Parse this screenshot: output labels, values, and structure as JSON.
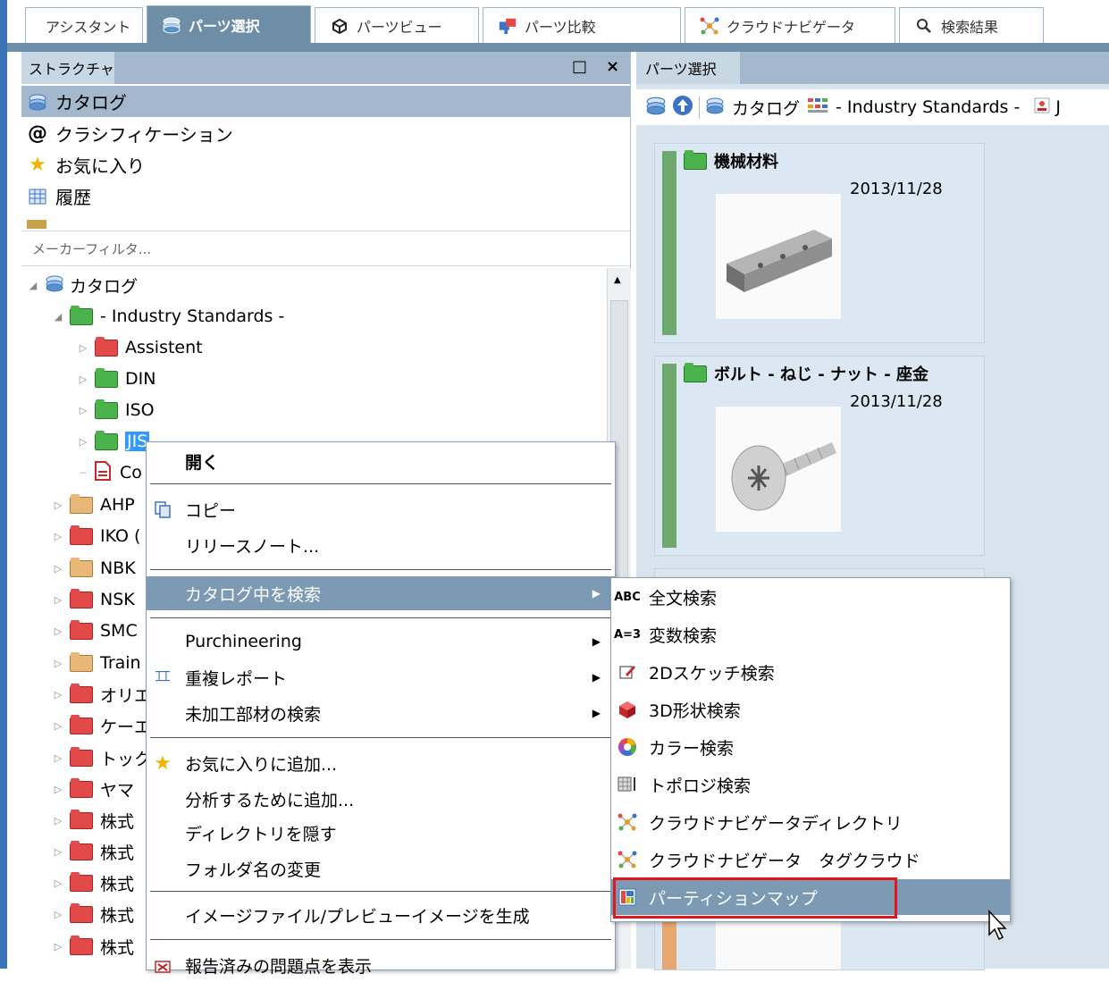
{
  "tabs": [
    {
      "label": "アシスタント",
      "icon": "none",
      "active": false
    },
    {
      "label": "パーツ選択",
      "icon": "catalog-icon",
      "active": true
    },
    {
      "label": "パーツビュー",
      "icon": "part-view-icon",
      "active": false
    },
    {
      "label": "パーツ比較",
      "icon": "compare-icon",
      "active": false
    },
    {
      "label": "クラウドナビゲータ",
      "icon": "cloud-nav-icon",
      "active": false
    },
    {
      "label": "検索結果",
      "icon": "search-icon",
      "active": false
    }
  ],
  "left_panel": {
    "title": "ストラクチャ",
    "maximize_glyph": "□",
    "close_glyph": "×",
    "nav": [
      {
        "label": "カタログ",
        "icon": "catalog-icon",
        "selected": true
      },
      {
        "label": "クラシフィケーション",
        "icon": "at-icon",
        "selected": false
      },
      {
        "label": "お気に入り",
        "icon": "star-icon",
        "selected": false
      },
      {
        "label": "履歴",
        "icon": "history-icon",
        "selected": false
      }
    ],
    "filter_placeholder": "メーカーフィルタ...",
    "tree": [
      {
        "label": "カタログ",
        "level": 0,
        "kind": "catalog"
      },
      {
        "label": "- Industry Standards -",
        "level": 1,
        "kind": "open-green"
      },
      {
        "label": "Assistent",
        "level": 2,
        "kind": "red"
      },
      {
        "label": "DIN",
        "level": 2,
        "kind": "green"
      },
      {
        "label": "ISO",
        "level": 2,
        "kind": "green"
      },
      {
        "label": "JIS",
        "level": 2,
        "kind": "green",
        "selected": true
      },
      {
        "label": "Co",
        "level": 2,
        "kind": "doc"
      },
      {
        "label": "AHP",
        "level": 1,
        "kind": "tan"
      },
      {
        "label": "IKO (",
        "level": 1,
        "kind": "red"
      },
      {
        "label": "NBK",
        "level": 1,
        "kind": "tan"
      },
      {
        "label": "NSK",
        "level": 1,
        "kind": "red"
      },
      {
        "label": "SMC",
        "level": 1,
        "kind": "red"
      },
      {
        "label": "Train",
        "level": 1,
        "kind": "tan"
      },
      {
        "label": "オリエ",
        "level": 1,
        "kind": "red"
      },
      {
        "label": "ケーエ",
        "level": 1,
        "kind": "red"
      },
      {
        "label": "トック",
        "level": 1,
        "kind": "red"
      },
      {
        "label": "ヤマ",
        "level": 1,
        "kind": "red"
      },
      {
        "label": "株式",
        "level": 1,
        "kind": "red"
      },
      {
        "label": "株式",
        "level": 1,
        "kind": "red"
      },
      {
        "label": "株式",
        "level": 1,
        "kind": "red"
      },
      {
        "label": "株式",
        "level": 1,
        "kind": "red"
      },
      {
        "label": "株式",
        "level": 1,
        "kind": "red"
      }
    ]
  },
  "right_panel": {
    "title": "パーツ選択",
    "breadcrumb": "カタログ",
    "breadcrumb2": "- Industry Standards -",
    "breadcrumb3": "J",
    "cards": [
      {
        "title": "機械材料",
        "date": "2013/11/28"
      },
      {
        "title": "ボルト - ねじ - ナット - 座金",
        "date": "2013/11/28"
      }
    ]
  },
  "context_menu": {
    "items": [
      {
        "label": "開く",
        "bold": true
      },
      {
        "label": "コピー",
        "icon": "copy-icon"
      },
      {
        "label": "リリースノート..."
      },
      {
        "label": "カタログ中を検索",
        "submenu": true,
        "highlight": true
      },
      {
        "label": "Purchineering",
        "submenu": true
      },
      {
        "label": "重複レポート",
        "submenu": true,
        "icon": "dup-icon"
      },
      {
        "label": "未加工部材の検索",
        "submenu": true
      },
      {
        "label": "お気に入りに追加...",
        "icon": "star-icon"
      },
      {
        "label": "分析するために追加..."
      },
      {
        "label": "ディレクトリを隠す"
      },
      {
        "label": "フォルダ名の変更"
      },
      {
        "label": "イメージファイル/プレビューイメージを生成"
      },
      {
        "label": "報告済みの問題点を表示",
        "icon": "report-icon"
      }
    ]
  },
  "submenu": {
    "items": [
      {
        "label": "全文検索",
        "icon_text": "ABC"
      },
      {
        "label": "変数検索",
        "icon_text": "A=3"
      },
      {
        "label": "2Dスケッチ検索",
        "icon": "sketch-icon"
      },
      {
        "label": "3D形状検索",
        "icon": "cube-icon"
      },
      {
        "label": "カラー検索",
        "icon": "color-wheel-icon"
      },
      {
        "label": "トポロジ検索",
        "icon": "topology-icon"
      },
      {
        "label": "クラウドナビゲータディレクトリ",
        "icon": "cloud-nav-icon"
      },
      {
        "label": "クラウドナビゲータ　タグクラウド",
        "icon": "cloud-nav-icon"
      },
      {
        "label": "パーティションマップ",
        "icon": "partition-map-icon",
        "highlight": true
      }
    ]
  },
  "colors": {
    "accent": "#6e8ea8",
    "highlight": "#7c9ab4",
    "marker": "#e0181e"
  }
}
